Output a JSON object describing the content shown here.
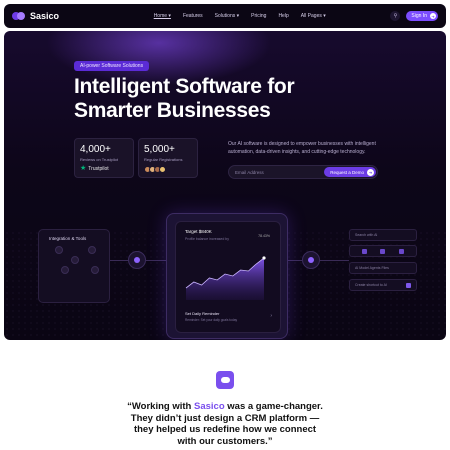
{
  "nav": {
    "brand": "Sasico",
    "links": [
      {
        "label": "Home ▾"
      },
      {
        "label": "Features"
      },
      {
        "label": "Solutions ▾"
      },
      {
        "label": "Pricing"
      },
      {
        "label": "Help"
      },
      {
        "label": "All Pages ▾"
      }
    ],
    "signin_label": "Sign In"
  },
  "hero": {
    "badge": "AI-power Software Solutions",
    "headline": "Intelligent Software for Smarter Businesses",
    "stats": [
      {
        "value": "4,000+",
        "label": "Reviews on Trustpilot",
        "sub": "Trustpilot"
      },
      {
        "value": "5,000+",
        "label": "Regular Registrations"
      }
    ],
    "description": "Our AI software is designed to empower businesses with intelligent automation, data-driven insights, and cutting-edge technology.",
    "email_placeholder": "Email Address",
    "request_label": "Request a Demo"
  },
  "integration": {
    "title": "Integration & Tools"
  },
  "center_card": {
    "title": "Target $840K",
    "subtitle": "Profile balance increased by",
    "percent": "78.43%",
    "reminder_title": "Set Daily Reminder",
    "reminder_sub": "Reminder: Set your daily goals today",
    "chart_values": [
      12,
      18,
      15,
      22,
      20,
      26,
      24,
      30,
      29,
      36,
      42
    ]
  },
  "right_panel": {
    "search_placeholder": "Search with AI",
    "options_text": "AI Model   Agents   Files",
    "input_placeholder": "Create shortcut to AI"
  },
  "quote": {
    "prefix": "“Working with ",
    "brand": "Sasico",
    "rest": " was a game-changer. They didn’t just design a CRM platform — they helped us redefine how we connect with our customers.”"
  },
  "colors": {
    "accent": "#7c4dff",
    "dark": "#0b0614"
  }
}
